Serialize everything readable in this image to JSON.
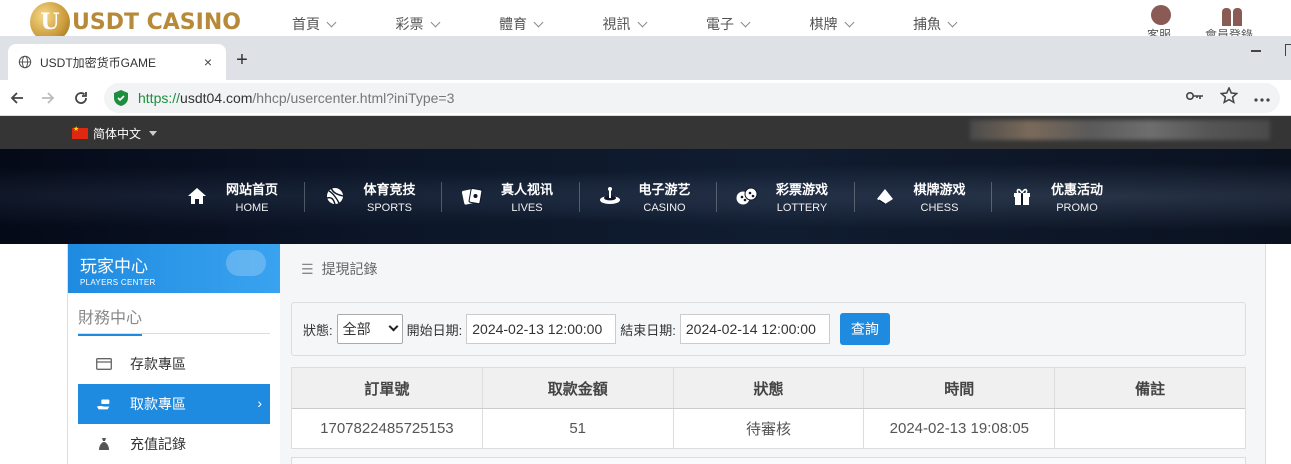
{
  "background_site": {
    "logo_letter": "U",
    "logo_text": "USDT CASINO",
    "nav": [
      "首頁",
      "彩票",
      "體育",
      "視訊",
      "電子",
      "棋牌",
      "捕魚"
    ],
    "right_labels": [
      "客服",
      "會員登錄"
    ]
  },
  "browser": {
    "tab_title": "USDT加密货币GAME",
    "tab_close": "×",
    "new_tab": "+",
    "url_scheme": "https://",
    "url_host": "usdt04.com",
    "url_path": "/hhcp/usercenter.html?iniType=3"
  },
  "page": {
    "language": "简体中文",
    "main_nav": [
      {
        "cn": "网站首页",
        "en": "HOME",
        "icon": "home-icon"
      },
      {
        "cn": "体育竞技",
        "en": "SPORTS",
        "icon": "ball-icon"
      },
      {
        "cn": "真人视讯",
        "en": "LIVES",
        "icon": "cards-icon"
      },
      {
        "cn": "电子游艺",
        "en": "CASINO",
        "icon": "roulette-icon"
      },
      {
        "cn": "彩票游戏",
        "en": "LOTTERY",
        "icon": "dice-icon"
      },
      {
        "cn": "棋牌游戏",
        "en": "CHESS",
        "icon": "chips-icon"
      },
      {
        "cn": "优惠活动",
        "en": "PROMO",
        "icon": "gift-icon"
      }
    ],
    "sidebar": {
      "header_cn": "玩家中心",
      "header_en": "PLAYERS CENTER",
      "section": "財務中心",
      "items": [
        {
          "label": "存款專區",
          "icon": "card-icon",
          "active": false
        },
        {
          "label": "取款專區",
          "icon": "withdraw-icon",
          "active": true,
          "arrow": "›"
        },
        {
          "label": "充值記錄",
          "icon": "moneybag-icon",
          "active": false
        }
      ]
    },
    "main": {
      "breadcrumb_icon": "☰",
      "title": "提現記錄",
      "filter": {
        "status_label": "狀態:",
        "status_value": "全部",
        "start_label": "開始日期:",
        "start_value": "2024-02-13 12:00:00",
        "end_label": "結束日期:",
        "end_value": "2024-02-14 12:00:00",
        "query_button": "查詢"
      },
      "table": {
        "headers": [
          "訂單號",
          "取款金額",
          "狀態",
          "時間",
          "備註"
        ],
        "rows": [
          [
            "1707822485725153",
            "51",
            "待審核",
            "2024-02-13 19:08:05",
            ""
          ]
        ]
      }
    }
  },
  "colors": {
    "accent_blue": "#1f8be0",
    "topbar": "#353535",
    "url_green": "#1e8e3e",
    "logo_gold": "#b78a3a"
  }
}
